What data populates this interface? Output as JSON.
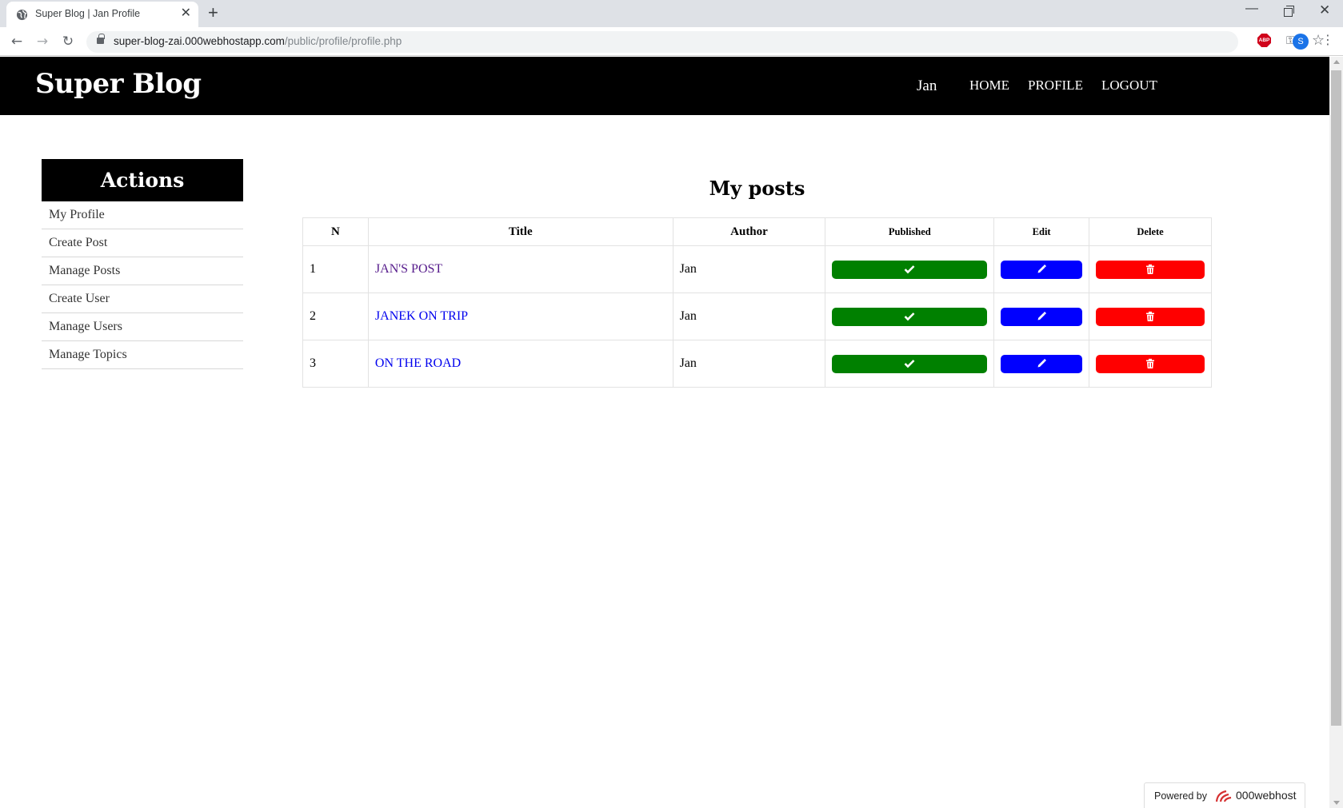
{
  "browser": {
    "tab_title": "Super Blog | Jan Profile",
    "url_host": "super-blog-zai.000webhostapp.com",
    "url_path": "/public/profile/profile.php",
    "profile_initial": "S",
    "abp_label": "ABP"
  },
  "header": {
    "logo": "Super Blog",
    "username": "Jan",
    "nav": {
      "home": "HOME",
      "profile": "PROFILE",
      "logout": "LOGOUT"
    }
  },
  "sidebar": {
    "title": "Actions",
    "items": [
      {
        "label": "My Profile"
      },
      {
        "label": "Create Post"
      },
      {
        "label": "Manage Posts"
      },
      {
        "label": "Create User"
      },
      {
        "label": "Manage Users"
      },
      {
        "label": "Manage Topics"
      }
    ]
  },
  "posts": {
    "title": "My posts",
    "columns": {
      "n": "N",
      "title": "Title",
      "author": "Author",
      "published": "Published",
      "edit": "Edit",
      "delete": "Delete"
    },
    "rows": [
      {
        "n": "1",
        "title": "JAN'S POST",
        "author": "Jan",
        "visited": true
      },
      {
        "n": "2",
        "title": "JANEK ON TRIP",
        "author": "Jan",
        "visited": false
      },
      {
        "n": "3",
        "title": "ON THE ROAD",
        "author": "Jan",
        "visited": false
      }
    ]
  },
  "footer": {
    "powered_label": "Powered by",
    "powered_brand": "000webhost"
  },
  "colors": {
    "header_bg": "#000000",
    "link": "#0000ee",
    "link_visited": "#551a8b",
    "publish_button": "#008000",
    "edit_button": "#0000ff",
    "delete_button": "#ff0000"
  },
  "icons": {
    "published": "check-icon",
    "edit": "pencil-icon",
    "delete": "trash-icon"
  }
}
